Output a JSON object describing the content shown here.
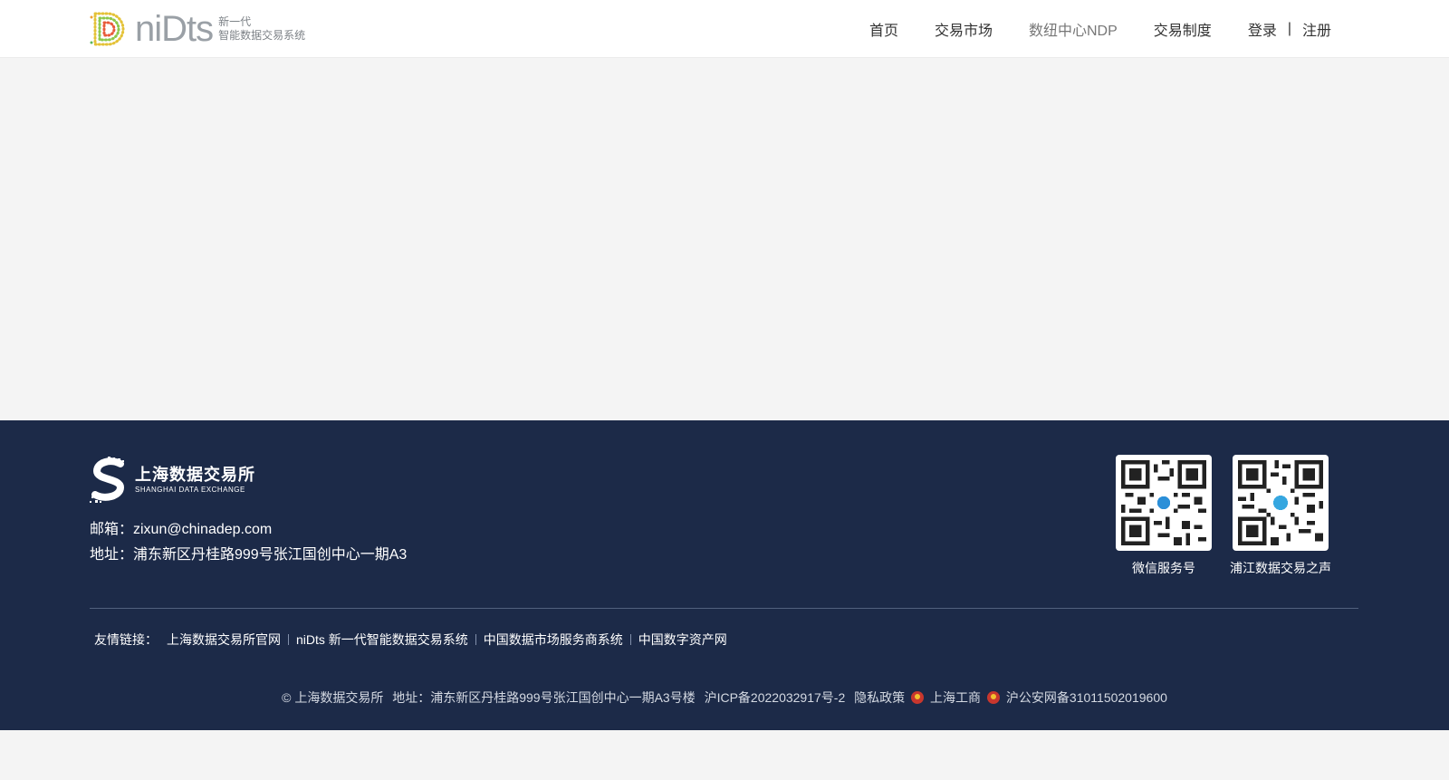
{
  "header": {
    "logo": {
      "word": "niDts",
      "sub_line1": "新一代",
      "sub_line2": "智能数据交易系统"
    },
    "nav": [
      {
        "label": "首页"
      },
      {
        "label": "交易市场"
      },
      {
        "label": "数纽中心NDP"
      },
      {
        "label": "交易制度"
      }
    ],
    "auth": {
      "login": "登录",
      "separator": "|",
      "register": "注册"
    }
  },
  "footer": {
    "logo": {
      "cn": "上海数据交易所",
      "en": "SHANGHAI DATA EXCHANGE"
    },
    "email": "邮箱：zixun@chinadep.com",
    "address": "地址：浦东新区丹桂路999号张江国创中心一期A3",
    "qrcodes": [
      {
        "label": "微信服务号"
      },
      {
        "label": "浦江数据交易之声"
      }
    ],
    "friend_links_label": "友情链接：",
    "friend_links": [
      "上海数据交易所官网",
      "niDts 新一代智能数据交易系统",
      "中国数据市场服务商系统",
      "中国数字资产网"
    ],
    "copyright": "© 上海数据交易所",
    "copy_address": "地址：浦东新区丹桂路999号张江国创中心一期A3号楼",
    "icp": "沪ICP备2022032917号-2",
    "privacy": "隐私政策",
    "business": "上海工商",
    "police": "沪公安网备31011502019600"
  },
  "colors": {
    "footer_bg": "#1c2a48",
    "page_bg": "#f4f4f4"
  }
}
